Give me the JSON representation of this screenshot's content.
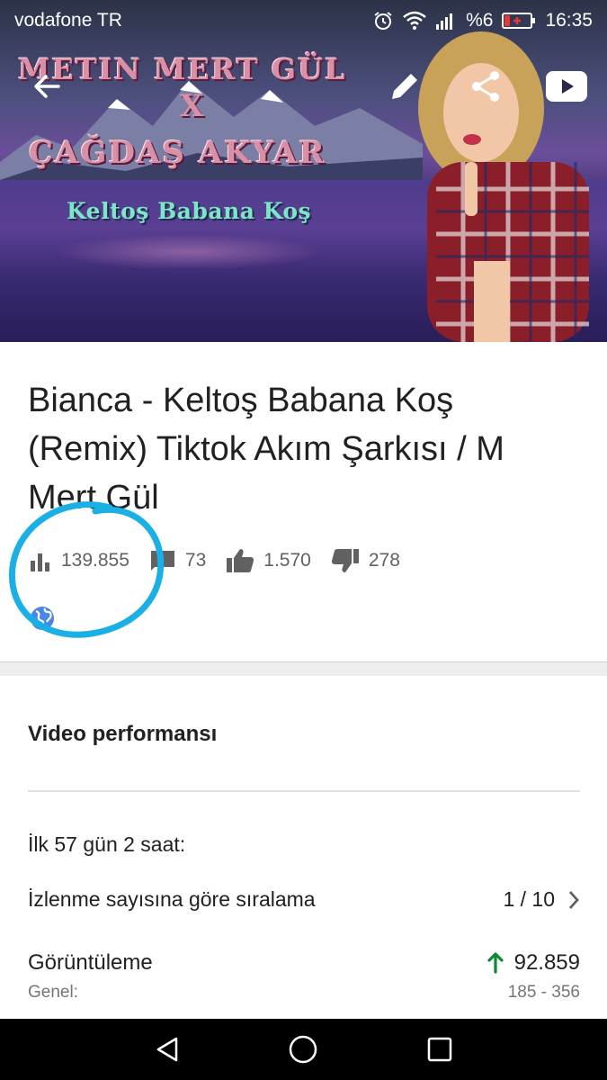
{
  "status_bar": {
    "carrier": "vodafone TR",
    "battery_percent": "%6",
    "time": "16:35",
    "icons": [
      "alarm-icon",
      "wifi-icon",
      "signal-icon",
      "battery-icon"
    ]
  },
  "banner": {
    "line1": "METIN MERT GÜL",
    "line_x": "X",
    "line2": "ÇAĞDAŞ  AKYAR",
    "line3": "Keltoş Babana Koş"
  },
  "top_actions": {
    "icons": [
      "back-arrow-icon",
      "edit-icon",
      "share-icon",
      "youtube-icon"
    ]
  },
  "video": {
    "title": "Bianca - Keltoş Babana Koş (Remix) Tiktok Akım Şarkısı / M Mert Gül",
    "stats": {
      "views": "139.855",
      "comments": "73",
      "likes": "1.570",
      "dislikes": "278"
    },
    "visibility_icon": "globe-icon"
  },
  "performance": {
    "section_title": "Video performansı",
    "period_label": "İlk 57 gün 2 saat:",
    "rank_label": "İzlenme sayısına göre sıralama",
    "rank_value": "1 / 10",
    "views_label": "Görüntüleme",
    "views_value": "92.859",
    "general_label": "Genel:",
    "general_range": "185 - 356"
  },
  "colors": {
    "up_arrow": "#0a8a2f",
    "highlight": "#1ab0e6",
    "globe": "#4a86e8"
  },
  "nav_bar": {
    "icons": [
      "back-triangle-icon",
      "home-circle-icon",
      "recents-square-icon"
    ]
  }
}
